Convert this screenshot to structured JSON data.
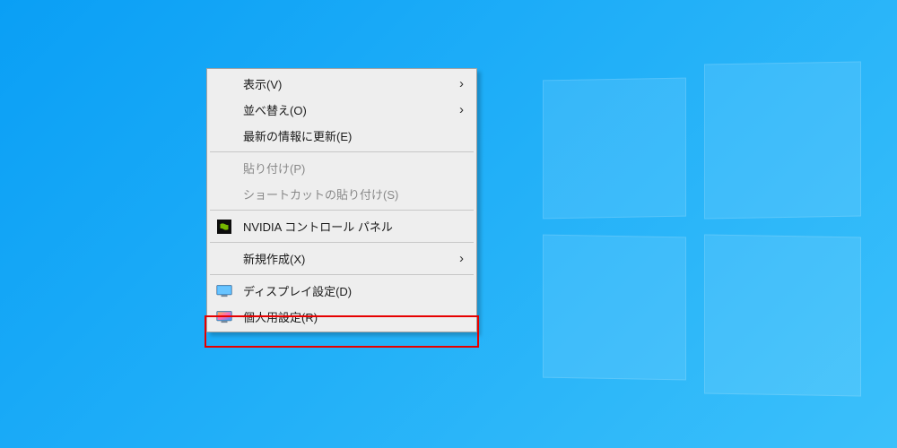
{
  "context_menu": {
    "items": {
      "view": {
        "label": "表示(V)"
      },
      "sort": {
        "label": "並べ替え(O)"
      },
      "refresh": {
        "label": "最新の情報に更新(E)"
      },
      "paste": {
        "label": "貼り付け(P)"
      },
      "paste_shortcut": {
        "label": "ショートカットの貼り付け(S)"
      },
      "nvidia": {
        "label": "NVIDIA コントロール パネル"
      },
      "new": {
        "label": "新規作成(X)"
      },
      "display_settings": {
        "label": "ディスプレイ設定(D)"
      },
      "personalize": {
        "label": "個人用設定(R)"
      }
    }
  }
}
